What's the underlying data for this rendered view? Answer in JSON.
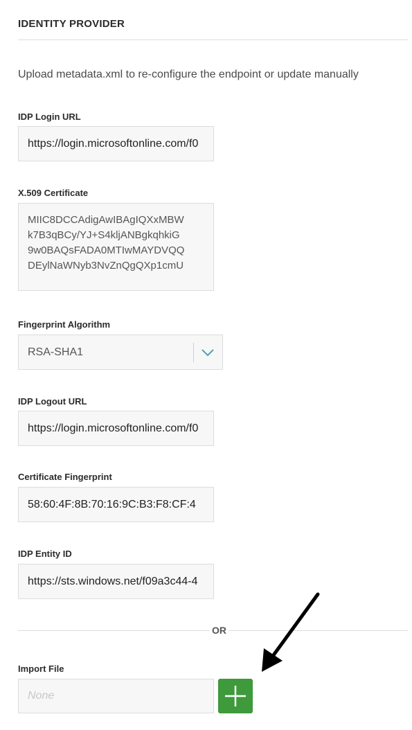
{
  "section": {
    "title": "IDENTITY PROVIDER",
    "description": "Upload metadata.xml to re-configure the endpoint or update manually"
  },
  "fields": {
    "idp_login_url": {
      "label": "IDP Login URL",
      "value": "https://login.microsoftonline.com/f0"
    },
    "x509_certificate": {
      "label": "X.509 Certificate",
      "lines": [
        "MIIC8DCCAdigAwIBAgIQXxMBW",
        "k7B3qBCy/YJ+S4kljANBgkqhkiG",
        "9w0BAQsFADA0MTIwMAYDVQQ",
        "DEylNaWNyb3NvZnQgQXp1cmU"
      ]
    },
    "fingerprint_algorithm": {
      "label": "Fingerprint Algorithm",
      "value": "RSA-SHA1"
    },
    "idp_logout_url": {
      "label": "IDP Logout URL",
      "value": "https://login.microsoftonline.com/f0"
    },
    "certificate_fingerprint": {
      "label": "Certificate Fingerprint",
      "value": "58:60:4F:8B:70:16:9C:B3:F8:CF:4"
    },
    "idp_entity_id": {
      "label": "IDP Entity ID",
      "value": "https://sts.windows.net/f09a3c44-4"
    }
  },
  "separator": {
    "text": "OR"
  },
  "import_file": {
    "label": "Import File",
    "placeholder": "None"
  },
  "icons": {
    "select_chevron": "chevron-down-icon",
    "add": "plus-icon",
    "annotation": "arrow-icon"
  },
  "colors": {
    "accent": "#4aa3b5",
    "add_button": "#3e9a3a",
    "field_background": "#f7f7f7",
    "field_border": "#dcdcdc",
    "annotation_arrow": "#000000"
  }
}
